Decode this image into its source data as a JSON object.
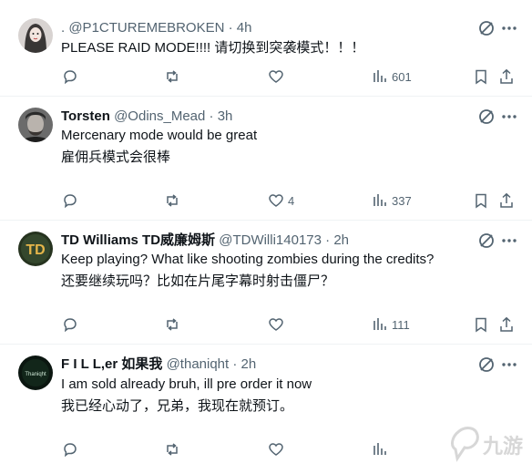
{
  "tweets": [
    {
      "name": "",
      "handle": ". @P1CTUREMEBROKEN",
      "time": "4h",
      "lines": [
        "PLEASE RAID MODE!!!!  请切换到突袭模式！！！"
      ],
      "likes": "",
      "views": "601",
      "avatar_color": "#c9c4c2"
    },
    {
      "name": "Torsten",
      "handle": "@Odins_Mead",
      "time": "3h",
      "lines": [
        "Mercenary mode would be great",
        "雇佣兵模式会很棒"
      ],
      "likes": "4",
      "views": "337",
      "avatar_color": "#5a5a5a"
    },
    {
      "name": "TD Williams TD威廉姆斯",
      "handle": "@TDWilli140173",
      "time": "2h",
      "lines": [
        "Keep playing? What like shooting zombies during the credits?",
        "还要继续玩吗？比如在片尾字幕时射击僵尸？"
      ],
      "likes": "",
      "views": "111",
      "avatar_color": "#2d3a2d",
      "avatar_text": "TD"
    },
    {
      "name": "F I L L,er 如果我",
      "handle": "@thaniqht",
      "time": "2h",
      "lines": [
        "I am sold already bruh, ill pre order it now",
        "我已经心动了，兄弟，我现在就预订。"
      ],
      "likes": "",
      "views": "",
      "avatar_color": "#0d1a12",
      "avatar_text": "Thaniqht"
    }
  ],
  "separator": "·",
  "watermark": "九游",
  "colors": {
    "text": "#0f1419",
    "secondary": "#536471",
    "border": "#eff3f4"
  }
}
